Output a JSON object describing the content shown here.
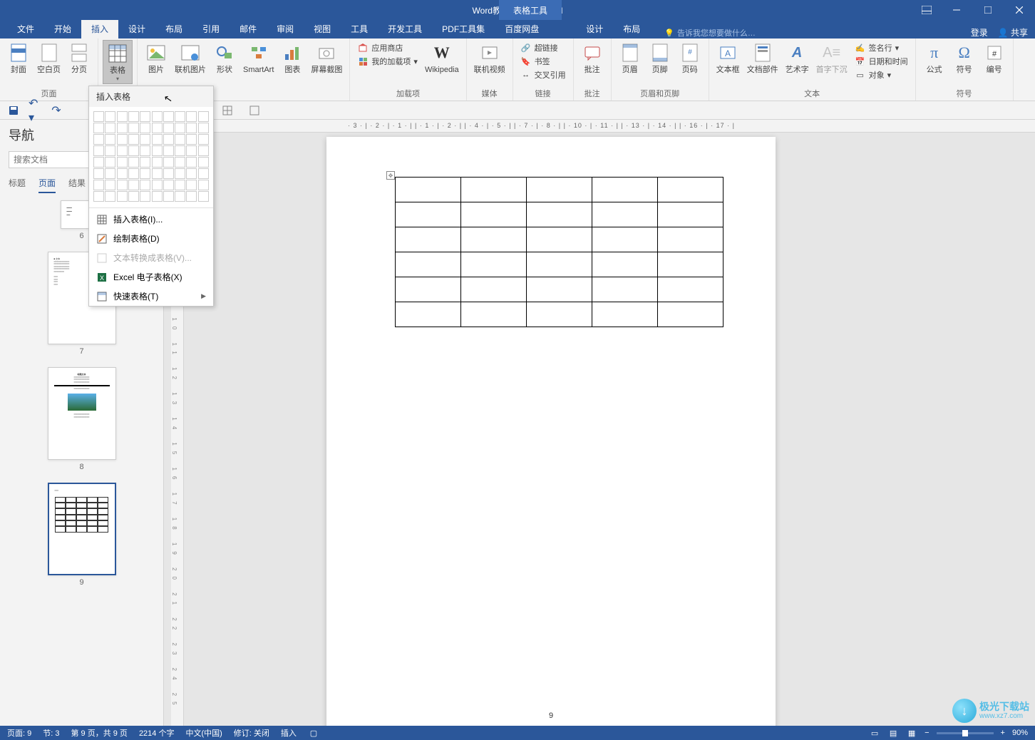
{
  "app": {
    "title": "Word教程2.docx - Word",
    "table_tools": "表格工具"
  },
  "window": {
    "login": "登录",
    "share": "共享"
  },
  "tabs": {
    "file": "文件",
    "home": "开始",
    "insert": "插入",
    "design": "设计",
    "layout": "布局",
    "references": "引用",
    "mailings": "邮件",
    "review": "审阅",
    "view": "视图",
    "tools": "工具",
    "developer": "开发工具",
    "pdf": "PDF工具集",
    "baidu": "百度网盘",
    "tbl_design": "设计",
    "tbl_layout": "布局",
    "tell_me": "告诉我您想要做什么…"
  },
  "ribbon": {
    "pages": {
      "cover": "封面",
      "blank": "空白页",
      "break": "分页",
      "group": "页面"
    },
    "tables": {
      "table": "表格"
    },
    "illustrations": {
      "picture": "图片",
      "online_pic": "联机图片",
      "shapes": "形状",
      "smartart": "SmartArt",
      "chart": "图表",
      "screenshot": "屏幕截图"
    },
    "addins": {
      "store": "应用商店",
      "myaddins": "我的加载项",
      "wikipedia": "Wikipedia",
      "group": "加载项"
    },
    "media": {
      "video": "联机视频",
      "group": "媒体"
    },
    "links": {
      "hyperlink": "超链接",
      "bookmark": "书签",
      "crossref": "交叉引用",
      "group": "链接"
    },
    "comments": {
      "comment": "批注",
      "group": "批注"
    },
    "headerfooter": {
      "header": "页眉",
      "footer": "页脚",
      "pagenum": "页码",
      "group": "页眉和页脚"
    },
    "text": {
      "textbox": "文本框",
      "quickparts": "文档部件",
      "wordart": "艺术字",
      "dropcap": "首字下沉",
      "signature": "签名行",
      "datetime": "日期和时间",
      "object": "对象",
      "group": "文本"
    },
    "symbols": {
      "equation": "公式",
      "symbol": "符号",
      "number": "编号",
      "group": "符号"
    }
  },
  "nav": {
    "title": "导航",
    "search_placeholder": "搜索文档",
    "tab_headings": "标题",
    "tab_pages": "页面",
    "tab_results": "结果",
    "p6": "6",
    "p7": "7",
    "p8": "8",
    "p9": "9"
  },
  "dropdown": {
    "header": "插入表格",
    "insert": "插入表格(I)...",
    "draw": "绘制表格(D)",
    "convert": "文本转换成表格(V)...",
    "excel": "Excel 电子表格(X)",
    "quick": "快速表格(T)"
  },
  "doc": {
    "page_num": "9"
  },
  "ruler": {
    "marks": "· 3 · | · 2 · | · 1 · |    | · 1 · | · 2 · |    | · 4 · | · 5 · |    | · 7 · | · 8 · |    | · 10 · | · 11 · |    | · 13 · | · 14 · |    | · 16 · | · 17 · |"
  },
  "status": {
    "page": "页面: 9",
    "section": "节: 3",
    "page_of": "第 9 页，共 9 页",
    "words": "2214 个字",
    "lang": "中文(中国)",
    "track": "修订: 关闭",
    "mode": "插入",
    "zoom": "90%"
  },
  "watermark": {
    "name": "极光下载站",
    "url": "www.xz7.com"
  }
}
